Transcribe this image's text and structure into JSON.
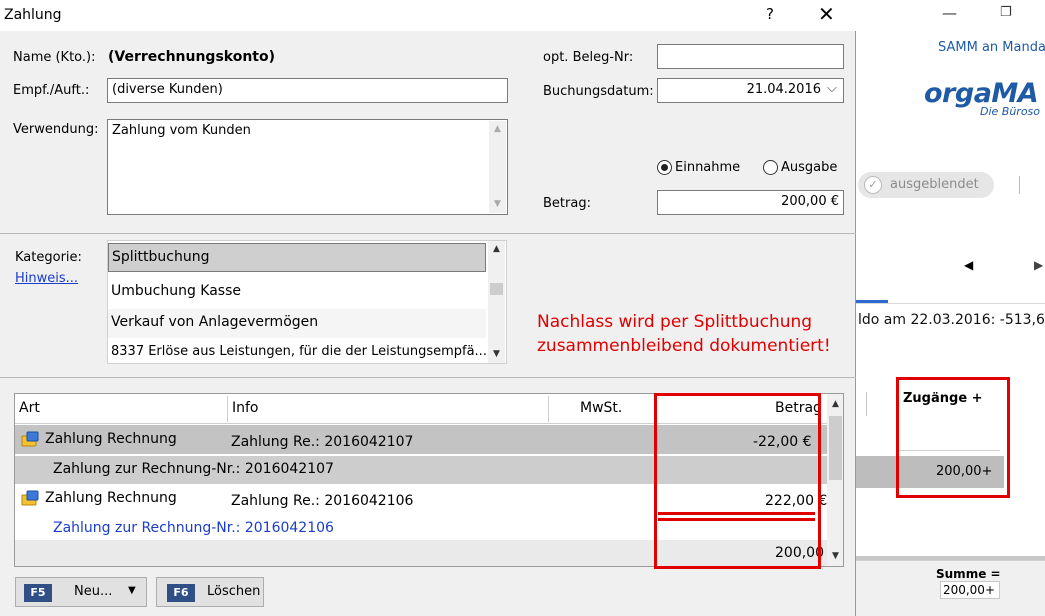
{
  "dialog": {
    "title": "Zahlung",
    "help_label": "?",
    "close_label": "✕",
    "name_label": "Name (Kto.):",
    "name_value": "(Verrechnungskonto)",
    "empf_label": "Empf./Auft.:",
    "empf_value": "(diverse Kunden)",
    "verwendung_label": "Verwendung:",
    "verwendung_value": "Zahlung vom Kunden",
    "beleg_label": "opt. Beleg-Nr:",
    "beleg_value": "",
    "datum_label": "Buchungsdatum:",
    "datum_value": "21.04.2016",
    "einnahme_label": "Einnahme",
    "ausgabe_label": "Ausgabe",
    "einnahme_selected": true,
    "betrag_label": "Betrag:",
    "betrag_value": "200,00 €",
    "kategorie_label": "Kategorie:",
    "hinweis_link": "Hinweis...",
    "categories": [
      "Splittbuchung",
      "Umbuchung Kasse",
      "Verkauf von Anlagevermögen",
      "8337 Erlöse aus Leistungen, für die der Leistungsempfä..."
    ],
    "selected_category": "Splittbuchung",
    "grid": {
      "columns": [
        "Art",
        "Info",
        "MwSt.",
        "Betrag"
      ],
      "rows": [
        {
          "art": "Zahlung Rechnung",
          "info": "Zahlung Re.: 2016042107",
          "betrag": "-22,00 €",
          "sub": "Zahlung zur Rechnung-Nr.: 2016042107"
        },
        {
          "art": "Zahlung Rechnung",
          "info": "Zahlung Re.: 2016042106",
          "betrag": "222,00 €",
          "sub": "Zahlung zur Rechnung-Nr.: 2016042106"
        }
      ],
      "sum": "200,00"
    },
    "buttons": {
      "new_key": "F5",
      "new_label": "Neu...",
      "delete_key": "F6",
      "delete_label": "Löschen"
    }
  },
  "annotation": {
    "line1": "Nachlass wird per Splittbuchung",
    "line2": "zusammenbleibend dokumentiert!",
    "color": "#e00000"
  },
  "background_app": {
    "link": "SAMM an Manda",
    "logo": "orgaMA",
    "logo_sub": "Die Büroso",
    "toggle_label": "ausgeblendet",
    "saldo": "ldo am 22.03.2016: -513,6",
    "column_header": "Zugänge +",
    "row_value": "200,00+",
    "summe_label": "Summe =",
    "summe_value": "200,00+"
  }
}
